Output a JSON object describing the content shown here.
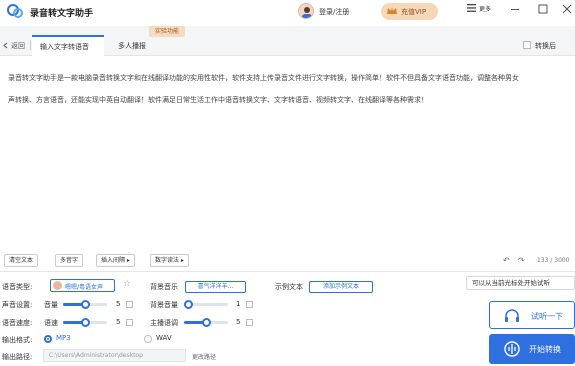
{
  "app": {
    "title": "录音转文字助手",
    "login": "登录/注册",
    "vip": "充值VIP",
    "more": "更多"
  },
  "tabs": {
    "back": "返回",
    "active": "输入文字转语音",
    "second": "多人播报",
    "badge": "实验功能",
    "checkbox_label": "转换后"
  },
  "content": {
    "text": "录音转文字助手是一款电脑录音转换文字和在线翻译功能的实用性软件，软件支持上传录音文件进行文字转换，操作简单！软件不但具备文字语音功能，调整各种男女\n声转换、方言语音，还能实现中英自动翻译！软件满足日常生活工作中语音转换文字、文字转语音、视频转文字、在线翻译等各种需求！"
  },
  "toolbar": {
    "clear": "清空文本",
    "polyphone": "多音字",
    "insert_pause": "插入间隔 ▸",
    "number_read": "数字读法 ▸",
    "counter": "133 / 3000"
  },
  "settings": {
    "voice_type_label": "语音类型:",
    "voice_name": "嗯嗯/粤语女声",
    "bgm_label": "背景音乐",
    "bgm_select": "喜气洋洋羊...",
    "example_label": "示例文本",
    "example_button": "添加示例文本",
    "voice_setting_label": "声音设置:",
    "volume_label": "音量",
    "volume_value": "5",
    "bg_volume_label": "背景音量",
    "bg_volume_value": "1",
    "speed_label": "语音速度:",
    "speed_sub_label": "语速",
    "speed_value": "5",
    "host_speed_label": "主播语调",
    "host_speed_value": "5",
    "format_label": "输出格式:",
    "format_mp3": "MP3",
    "format_wav": "WAV",
    "path_label": "输出路径:",
    "path_value": "C:\\Users\\Administrator\\desktop",
    "path_change": "更改路径"
  },
  "actions": {
    "tooltip": "可以从当前光标处开始试听",
    "listen": "试听一下",
    "start": "开始转换"
  },
  "levels": {
    "volume": 0.5,
    "bg_volume": 0.1,
    "speed": 0.5,
    "host_speed": 0.5
  },
  "colors": {
    "accent": "#2f6fe0",
    "vip_bg": "#f6d8b9"
  }
}
